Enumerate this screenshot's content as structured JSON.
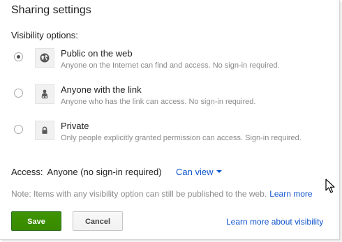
{
  "dialog": {
    "title": "Sharing settings",
    "visibility_label": "Visibility options:"
  },
  "options": [
    {
      "icon": "globe-icon",
      "title": "Public on the web",
      "description": "Anyone on the Internet can find and access. No sign-in required.",
      "selected": true
    },
    {
      "icon": "person-link-icon",
      "title": "Anyone with the link",
      "description": "Anyone who has the link can access. No sign-in required.",
      "selected": false
    },
    {
      "icon": "lock-icon",
      "title": "Private",
      "description": "Only people explicitly granted permission can access. Sign-in required.",
      "selected": false
    }
  ],
  "access": {
    "label": "Access:",
    "value": "Anyone (no sign-in required)",
    "permission": "Can view"
  },
  "note": {
    "text": "Note: Items with any visibility option can still be published to the web.",
    "link": "Learn more"
  },
  "buttons": {
    "save": "Save",
    "cancel": "Cancel"
  },
  "footer_link": "Learn more about visibility",
  "colors": {
    "save_green": "#3d9400",
    "link_blue": "#1155cc",
    "muted_text": "#8a8a8a"
  }
}
